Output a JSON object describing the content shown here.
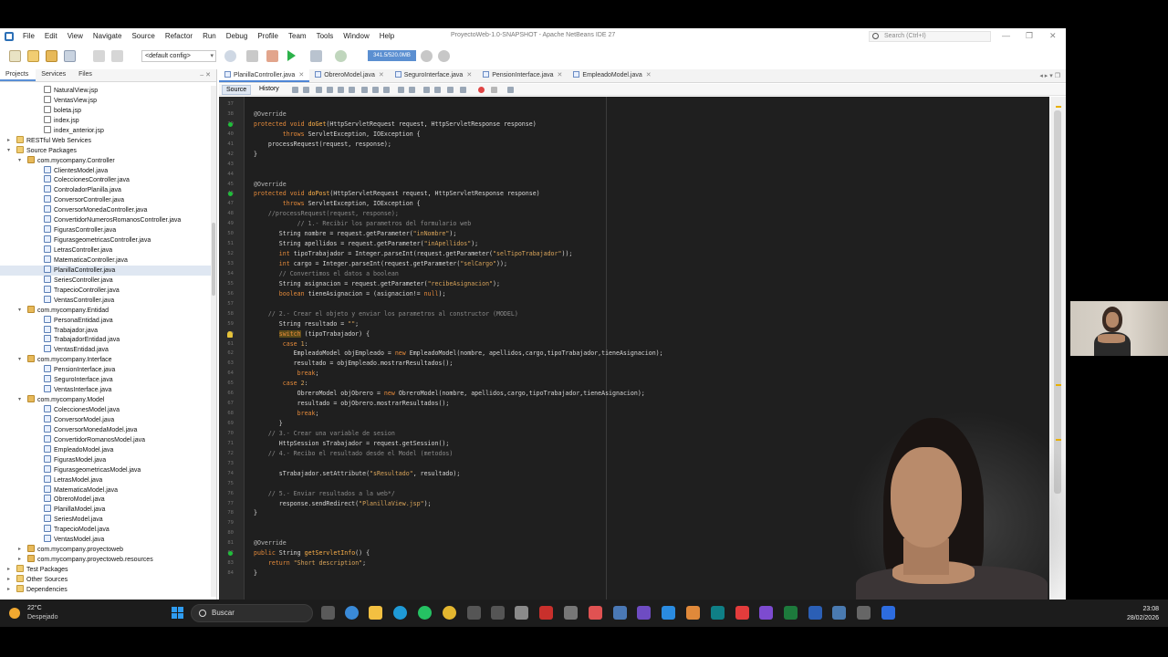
{
  "window": {
    "title": "ProyectoWeb-1.0-SNAPSHOT - Apache NetBeans IDE 27",
    "search_placeholder": "Search (Ctrl+I)",
    "menu": [
      "File",
      "Edit",
      "View",
      "Navigate",
      "Source",
      "Refactor",
      "Run",
      "Debug",
      "Profile",
      "Team",
      "Tools",
      "Window",
      "Help"
    ]
  },
  "toolbar": {
    "config": "<default config>",
    "memory": "341.5/520.0MB"
  },
  "project_panel": {
    "tabs": [
      "Projects",
      "Services",
      "Files"
    ],
    "tree": [
      {
        "label": "NaturalView.jsp",
        "depth": 3,
        "type": "file"
      },
      {
        "label": "VentasView.jsp",
        "depth": 3,
        "type": "file"
      },
      {
        "label": "boleta.jsp",
        "depth": 3,
        "type": "file"
      },
      {
        "label": "index.jsp",
        "depth": 3,
        "type": "file"
      },
      {
        "label": "index_anterior.jsp",
        "depth": 3,
        "type": "file"
      },
      {
        "label": "RESTful Web Services",
        "depth": 1,
        "type": "fold"
      },
      {
        "label": "Source Packages",
        "depth": 1,
        "type": "fold"
      },
      {
        "label": "com.mycompany.Controller",
        "depth": 2,
        "type": "pkg"
      },
      {
        "label": "ClientesModel.java",
        "depth": 3,
        "type": "java"
      },
      {
        "label": "ColeccionesController.java",
        "depth": 3,
        "type": "java"
      },
      {
        "label": "ControladorPlanilla.java",
        "depth": 3,
        "type": "java"
      },
      {
        "label": "ConversorController.java",
        "depth": 3,
        "type": "java"
      },
      {
        "label": "ConversorMonedaController.java",
        "depth": 3,
        "type": "java"
      },
      {
        "label": "ConvertidorNumerosRomanosController.java",
        "depth": 3,
        "type": "java"
      },
      {
        "label": "FigurasController.java",
        "depth": 3,
        "type": "java"
      },
      {
        "label": "FigurasgeometricasController.java",
        "depth": 3,
        "type": "java"
      },
      {
        "label": "LetrasController.java",
        "depth": 3,
        "type": "java"
      },
      {
        "label": "MatematicaController.java",
        "depth": 3,
        "type": "java"
      },
      {
        "label": "PlanillaController.java",
        "depth": 3,
        "type": "java",
        "selected": true
      },
      {
        "label": "SeriesController.java",
        "depth": 3,
        "type": "java"
      },
      {
        "label": "TrapecioController.java",
        "depth": 3,
        "type": "java"
      },
      {
        "label": "VentasController.java",
        "depth": 3,
        "type": "java"
      },
      {
        "label": "com.mycompany.Entidad",
        "depth": 2,
        "type": "pkg"
      },
      {
        "label": "PersonaEntidad.java",
        "depth": 3,
        "type": "java"
      },
      {
        "label": "Trabajador.java",
        "depth": 3,
        "type": "java"
      },
      {
        "label": "TrabajadorEntidad.java",
        "depth": 3,
        "type": "java"
      },
      {
        "label": "VentasEntidad.java",
        "depth": 3,
        "type": "java"
      },
      {
        "label": "com.mycompany.Interface",
        "depth": 2,
        "type": "pkg"
      },
      {
        "label": "PensionInterface.java",
        "depth": 3,
        "type": "java"
      },
      {
        "label": "SeguroInterface.java",
        "depth": 3,
        "type": "java"
      },
      {
        "label": "VentasInterface.java",
        "depth": 3,
        "type": "java"
      },
      {
        "label": "com.mycompany.Model",
        "depth": 2,
        "type": "pkg"
      },
      {
        "label": "ColeccionesModel.java",
        "depth": 3,
        "type": "java"
      },
      {
        "label": "ConversorModel.java",
        "depth": 3,
        "type": "java"
      },
      {
        "label": "ConversorMonedaModel.java",
        "depth": 3,
        "type": "java"
      },
      {
        "label": "ConvertidorRomanosModel.java",
        "depth": 3,
        "type": "java"
      },
      {
        "label": "EmpleadoModel.java",
        "depth": 3,
        "type": "java"
      },
      {
        "label": "FigurasModel.java",
        "depth": 3,
        "type": "java"
      },
      {
        "label": "FigurasgeometricasModel.java",
        "depth": 3,
        "type": "java"
      },
      {
        "label": "LetrasModel.java",
        "depth": 3,
        "type": "java"
      },
      {
        "label": "MatematicaModel.java",
        "depth": 3,
        "type": "java"
      },
      {
        "label": "ObreroModel.java",
        "depth": 3,
        "type": "java"
      },
      {
        "label": "PlanillaModel.java",
        "depth": 3,
        "type": "java"
      },
      {
        "label": "SeriesModel.java",
        "depth": 3,
        "type": "java"
      },
      {
        "label": "TrapecioModel.java",
        "depth": 3,
        "type": "java"
      },
      {
        "label": "VentasModel.java",
        "depth": 3,
        "type": "java"
      },
      {
        "label": "com.mycompany.proyectoweb",
        "depth": 2,
        "type": "pkg"
      },
      {
        "label": "com.mycompany.proyectoweb.resources",
        "depth": 2,
        "type": "pkg"
      },
      {
        "label": "Test Packages",
        "depth": 1,
        "type": "fold"
      },
      {
        "label": "Other Sources",
        "depth": 1,
        "type": "fold"
      },
      {
        "label": "Dependencies",
        "depth": 1,
        "type": "fold"
      }
    ]
  },
  "editor": {
    "tabs": [
      "PlanillaController.java",
      "ObreroModel.java",
      "SeguroInterface.java",
      "PensionInterface.java",
      "EmpleadoModel.java"
    ],
    "modes": [
      "Source",
      "History"
    ],
    "lines": [
      {
        "n": "37",
        "html": ""
      },
      {
        "n": "38",
        "html": "<span class='an'>@Override</span>"
      },
      {
        "n": "39",
        "html": "<span class='k'>protected void</span> <span class='m'>doGet</span>(HttpServletRequest request, HttpServletResponse response)",
        "mark": "green"
      },
      {
        "n": "40",
        "html": "        <span class='k'>throws</span> ServletException, IOException {"
      },
      {
        "n": "41",
        "html": "    processRequest(request, response);"
      },
      {
        "n": "42",
        "html": "}"
      },
      {
        "n": "43",
        "html": ""
      },
      {
        "n": "44",
        "html": ""
      },
      {
        "n": "45",
        "html": "<span class='an'>@Override</span>"
      },
      {
        "n": "46",
        "html": "<span class='k'>protected void</span> <span class='m'>doPost</span>(HttpServletRequest request, HttpServletResponse response)",
        "mark": "green"
      },
      {
        "n": "47",
        "html": "        <span class='k'>throws</span> ServletException, IOException {"
      },
      {
        "n": "48",
        "html": "    <span class='c'>//processRequest(request, response);</span>"
      },
      {
        "n": "49",
        "html": "            <span class='c'>// 1.- Recibir los parametros del formulario web</span>"
      },
      {
        "n": "50",
        "html": "       String nombre = request.getParameter(<span class='s'>\"inNombre\"</span>);"
      },
      {
        "n": "51",
        "html": "       String apellidos = request.getParameter(<span class='s'>\"inApellidos\"</span>);"
      },
      {
        "n": "52",
        "html": "       <span class='k'>int</span> tipoTrabajador = Integer.parseInt(request.getParameter(<span class='s'>\"selTipoTrabajador\"</span>));"
      },
      {
        "n": "53",
        "html": "       <span class='k'>int</span> cargo = Integer.parseInt(request.getParameter(<span class='s'>\"selCargo\"</span>));"
      },
      {
        "n": "54",
        "html": "       <span class='c'>// Convertimos el datos a boolean</span>"
      },
      {
        "n": "55",
        "html": "       String asignacion = request.getParameter(<span class='s'>\"recibeAsignacion\"</span>);"
      },
      {
        "n": "56",
        "html": "       <span class='k'>boolean</span> tieneAsignacion = (asignacion!= <span class='k'>null</span>);"
      },
      {
        "n": "57",
        "html": ""
      },
      {
        "n": "58",
        "html": "    <span class='c'>// 2.- Crear el objeto y enviar los parametros al constructor (MODEL)</span>"
      },
      {
        "n": "59",
        "html": "       String resultado = <span class='s'>\"\"</span>;"
      },
      {
        "n": "60",
        "html": "       <span class='k sw'>switch</span> (tipoTrabajador) {",
        "mark": "bulb"
      },
      {
        "n": "61",
        "html": "        <span class='k'>case</span> <span class='s'>1</span>:"
      },
      {
        "n": "62",
        "html": "           EmpleadoModel objEmpleado = <span class='k'>new</span> EmpleadoModel(nombre, apellidos,cargo,tipoTrabajador,tieneAsignacion);"
      },
      {
        "n": "63",
        "html": "           resultado = objEmpleado.mostrarResultados();"
      },
      {
        "n": "64",
        "html": "            <span class='k'>break</span>;"
      },
      {
        "n": "65",
        "html": "        <span class='k'>case</span> <span class='s'>2</span>:"
      },
      {
        "n": "66",
        "html": "            ObreroModel objObrero = <span class='k'>new</span> ObreroModel(nombre, apellidos,cargo,tipoTrabajador,tieneAsignacion);"
      },
      {
        "n": "67",
        "html": "            resultado = objObrero.mostrarResultados();"
      },
      {
        "n": "68",
        "html": "            <span class='k'>break</span>;"
      },
      {
        "n": "69",
        "html": "       }"
      },
      {
        "n": "70",
        "html": "    <span class='c'>// 3.- Crear una variable de sesion</span>"
      },
      {
        "n": "71",
        "html": "       HttpSession sTrabajador = request.getSession();"
      },
      {
        "n": "72",
        "html": "    <span class='c'>// 4.- Recibo el resultado desde el Model (metodos)</span>"
      },
      {
        "n": "73",
        "html": ""
      },
      {
        "n": "74",
        "html": "       sTrabajador.setAttribute(<span class='s'>\"sResultado\"</span>, resultado);"
      },
      {
        "n": "75",
        "html": ""
      },
      {
        "n": "76",
        "html": "    <span class='c'>// 5.- Enviar resultados a la web*/</span>"
      },
      {
        "n": "77",
        "html": "       response.sendRedirect(<span class='s'>\"PlanillaView.jsp\"</span>);"
      },
      {
        "n": "78",
        "html": "}"
      },
      {
        "n": "79",
        "html": ""
      },
      {
        "n": "80",
        "html": ""
      },
      {
        "n": "81",
        "html": "<span class='an'>@Override</span>"
      },
      {
        "n": "82",
        "html": "<span class='k'>public</span> String <span class='m'>getServletInfo</span>() {",
        "mark": "green"
      },
      {
        "n": "83",
        "html": "    <span class='k'>return</span> <span class='s'>\"Short description\"</span>;"
      },
      {
        "n": "84",
        "html": "}"
      }
    ]
  },
  "taskbar": {
    "temperature": "22°C",
    "weather": "Despejado",
    "search": "Buscar",
    "time": "23:08",
    "date": "28/02/2026"
  },
  "colors": {
    "editor_bg": "#1f1f1f",
    "keyword": "#e58a3a",
    "taskbar": "#1c1c1c",
    "accent": "#2f9cf0"
  }
}
